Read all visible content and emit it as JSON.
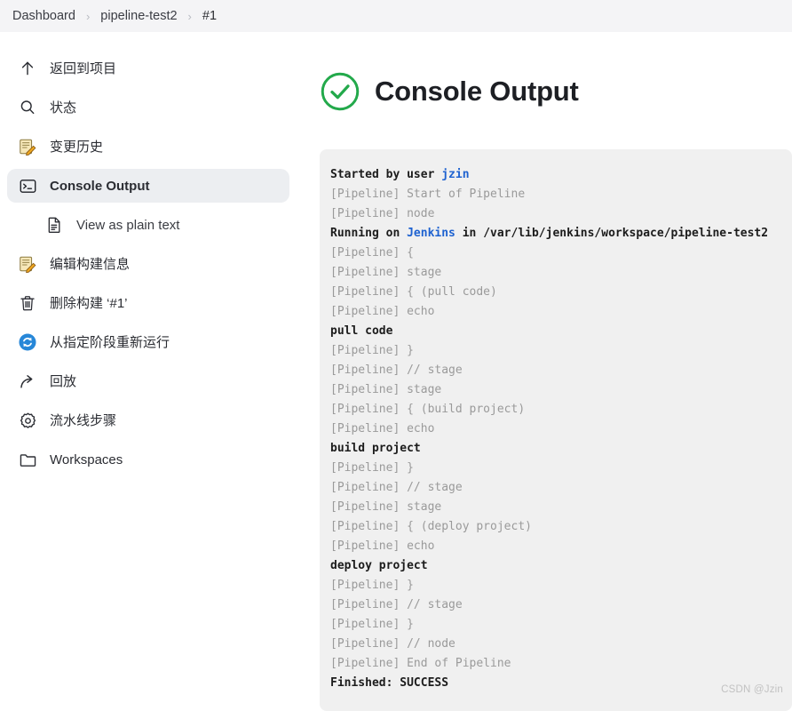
{
  "breadcrumb": {
    "separator": "›",
    "items": [
      {
        "label": "Dashboard",
        "icon": "none"
      },
      {
        "label": "pipeline-test2",
        "icon": "none"
      },
      {
        "label": "#1",
        "icon": "none"
      }
    ]
  },
  "sidebar": {
    "items": [
      {
        "label": "返回到项目",
        "icon": "arrow-up-icon",
        "active": false,
        "sub": false
      },
      {
        "label": "状态",
        "icon": "search-icon",
        "active": false,
        "sub": false
      },
      {
        "label": "变更历史",
        "icon": "notepad-pencil-icon",
        "active": false,
        "sub": false
      },
      {
        "label": "Console Output",
        "icon": "terminal-icon",
        "active": true,
        "sub": false
      },
      {
        "label": "View as plain text",
        "icon": "document-icon",
        "active": false,
        "sub": true
      },
      {
        "label": "编辑构建信息",
        "icon": "notepad-pencil-icon",
        "active": false,
        "sub": false
      },
      {
        "label": "删除构建 ‘#1’",
        "icon": "trash-icon",
        "active": false,
        "sub": false
      },
      {
        "label": "从指定阶段重新运行",
        "icon": "restart-circle-icon",
        "active": false,
        "sub": false
      },
      {
        "label": "回放",
        "icon": "replay-arrow-icon",
        "active": false,
        "sub": false
      },
      {
        "label": "流水线步骤",
        "icon": "gear-icon",
        "active": false,
        "sub": false
      },
      {
        "label": "Workspaces",
        "icon": "folder-icon",
        "active": false,
        "sub": false
      }
    ]
  },
  "main": {
    "title": "Console Output",
    "status_icon": "success-check-circle-icon",
    "status_color": "#23a94b",
    "console_lines": [
      {
        "text": "Started by user ",
        "kind": "out",
        "link": "jzin",
        "tail": ""
      },
      {
        "text": "[Pipeline] Start of Pipeline",
        "kind": "pipeline"
      },
      {
        "text": "[Pipeline] node",
        "kind": "pipeline"
      },
      {
        "text": "Running on ",
        "kind": "out",
        "link": "Jenkins",
        "tail": " in /var/lib/jenkins/workspace/pipeline-test2"
      },
      {
        "text": "[Pipeline] {",
        "kind": "pipeline"
      },
      {
        "text": "[Pipeline] stage",
        "kind": "pipeline"
      },
      {
        "text": "[Pipeline] { (pull code)",
        "kind": "pipeline"
      },
      {
        "text": "[Pipeline] echo",
        "kind": "pipeline"
      },
      {
        "text": "pull code",
        "kind": "out"
      },
      {
        "text": "[Pipeline] }",
        "kind": "pipeline"
      },
      {
        "text": "[Pipeline] // stage",
        "kind": "pipeline"
      },
      {
        "text": "[Pipeline] stage",
        "kind": "pipeline"
      },
      {
        "text": "[Pipeline] { (build project)",
        "kind": "pipeline"
      },
      {
        "text": "[Pipeline] echo",
        "kind": "pipeline"
      },
      {
        "text": "build project",
        "kind": "out"
      },
      {
        "text": "[Pipeline] }",
        "kind": "pipeline"
      },
      {
        "text": "[Pipeline] // stage",
        "kind": "pipeline"
      },
      {
        "text": "[Pipeline] stage",
        "kind": "pipeline"
      },
      {
        "text": "[Pipeline] { (deploy project)",
        "kind": "pipeline"
      },
      {
        "text": "[Pipeline] echo",
        "kind": "pipeline"
      },
      {
        "text": "deploy project",
        "kind": "out"
      },
      {
        "text": "[Pipeline] }",
        "kind": "pipeline"
      },
      {
        "text": "[Pipeline] // stage",
        "kind": "pipeline"
      },
      {
        "text": "[Pipeline] }",
        "kind": "pipeline"
      },
      {
        "text": "[Pipeline] // node",
        "kind": "pipeline"
      },
      {
        "text": "[Pipeline] End of Pipeline",
        "kind": "pipeline"
      },
      {
        "text": "Finished: SUCCESS",
        "kind": "out"
      }
    ]
  },
  "watermark": {
    "text": "CSDN @Jzin"
  },
  "colors": {
    "page_bg": "#ffffff",
    "breadcrumb_bg": "#f4f4f6",
    "console_bg": "#f0f0f0",
    "pipeline_text": "#9a9a9a",
    "output_text": "#1c1c1c",
    "link": "#1e62d0",
    "active_item_bg": "#eceef1",
    "success_green": "#23a94b",
    "restart_blue": "#2787d8"
  }
}
